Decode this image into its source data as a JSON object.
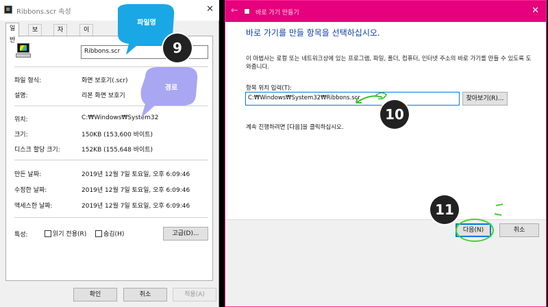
{
  "properties": {
    "title": "Ribbons.scr 속성",
    "tabs": [
      "일반",
      "보안",
      "자세히",
      "이전 버전"
    ],
    "filename": "Ribbons.scr",
    "fields": [
      {
        "label": "파일 형식:",
        "value": "화면 보호기(.scr)"
      },
      {
        "label": "설명:",
        "value": "리본 화면 보호기"
      },
      {
        "label": "위치:",
        "value": "C:₩Windows₩System32"
      },
      {
        "label": "크기:",
        "value": "150KB (153,600 바이트)"
      },
      {
        "label": "디스크 할당 크기:",
        "value": "152KB (155,648 바이트)"
      },
      {
        "label": "만든 날짜:",
        "value": "2019년 12월 7일 토요일, 오후 6:09:46"
      },
      {
        "label": "수정한 날짜:",
        "value": "2019년 12월 7일 토요일, 오후 6:09:46"
      },
      {
        "label": "액세스한 날짜:",
        "value": "2019년 12월 7일 토요일, 오후 6:09:46"
      }
    ],
    "attributes_label": "특성:",
    "readonly_label": "읽기 전용(R)",
    "hidden_label": "숨김(H)",
    "advanced_button": "고급(D)...",
    "ok_button": "확인",
    "cancel_button": "취소",
    "apply_button": "적용(A)"
  },
  "wizard": {
    "title": "바로 가기 만들기",
    "heading": "바로 가기를 만들 항목을 선택하십시오.",
    "description": "이 마법사는 로컬 또는 네트워크상에 있는 프로그램, 파일, 폴더, 컴퓨터, 인터넷 주소의 바로 가기를 만들 수 있도록 도와줍니다.",
    "location_label": "항목 위치 입력(T):",
    "location_value": "C:₩Windows₩System32₩Ribbons.scr",
    "browse_button": "찾아보기(R)...",
    "hint": "계속 진행하려면 [다음]을 클릭하십시오.",
    "next_button": "다음(N)",
    "cancel_button": "취소"
  },
  "annotations": {
    "bubble_filename": "파일명",
    "bubble_path": "경로",
    "step9": "9",
    "step10": "10",
    "step11": "11",
    "colors": {
      "bubble_blue": "#1aa7e6",
      "bubble_lavender": "#a9a7f2",
      "arrow_green": "#3bbf2a"
    }
  }
}
